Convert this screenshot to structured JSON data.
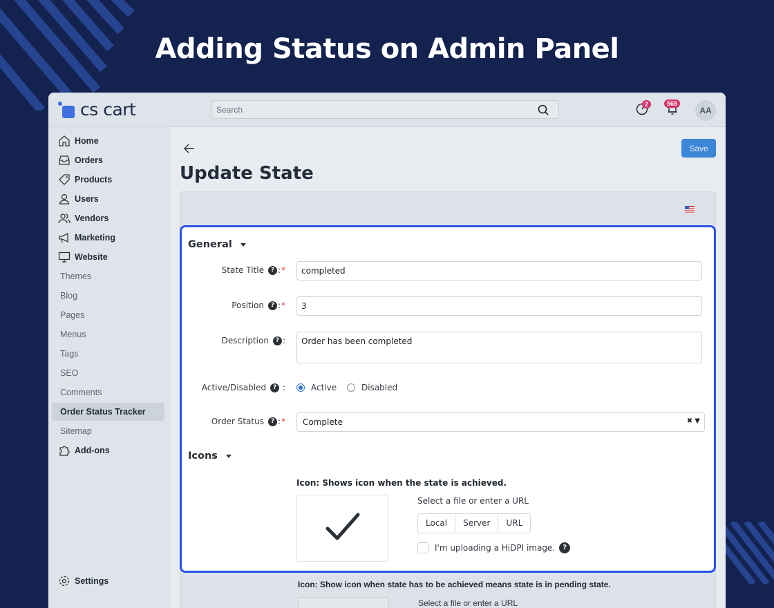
{
  "banner": {
    "title": "Adding Status on Admin Panel"
  },
  "header": {
    "logo_text": "cs cart",
    "search_placeholder": "Search",
    "help_badge": "2",
    "notif_badge": "565",
    "avatar_initials": "AA"
  },
  "sidebar": {
    "main_items": [
      {
        "label": "Home",
        "icon": "home-icon"
      },
      {
        "label": "Orders",
        "icon": "inbox-icon"
      },
      {
        "label": "Products",
        "icon": "tag-icon"
      },
      {
        "label": "Users",
        "icon": "user-icon"
      },
      {
        "label": "Vendors",
        "icon": "users-icon"
      },
      {
        "label": "Marketing",
        "icon": "megaphone-icon"
      },
      {
        "label": "Website",
        "icon": "monitor-icon"
      }
    ],
    "sub_items": [
      "Themes",
      "Blog",
      "Pages",
      "Menus",
      "Tags",
      "SEO",
      "Comments",
      "Order Status Tracker",
      "Sitemap"
    ],
    "active_sub": "Order Status Tracker",
    "addons": "Add-ons",
    "settings": "Settings"
  },
  "main": {
    "save_label": "Save",
    "page_title": "Update State"
  },
  "form": {
    "general_title": "General",
    "state_title_label": "State Title",
    "state_title_value": "completed",
    "position_label": "Position",
    "position_value": "3",
    "description_label": "Description",
    "description_value": "Order has been completed",
    "active_label": "Active/Disabled",
    "active_option": "Active",
    "disabled_option": "Disabled",
    "selected": "Active",
    "order_status_label": "Order Status",
    "order_status_value": "Complete",
    "icons_title": "Icons",
    "icon_caption": "Icon: Shows icon when the state is achieved.",
    "file_text": "Select a file or enter a URL",
    "upload_buttons": [
      "Local",
      "Server",
      "URL"
    ],
    "hidpi_label": "I'm uploading a HiDPI image."
  },
  "lower": {
    "icon_caption_pending": "Icon: Show icon when state has to be achieved means state is in pending state.",
    "file_text": "Select a file or enter a URL"
  },
  "colors": {
    "accent": "#2a52e6",
    "save": "#3c86d8",
    "badge": "#d63369",
    "background": "#13224f"
  }
}
